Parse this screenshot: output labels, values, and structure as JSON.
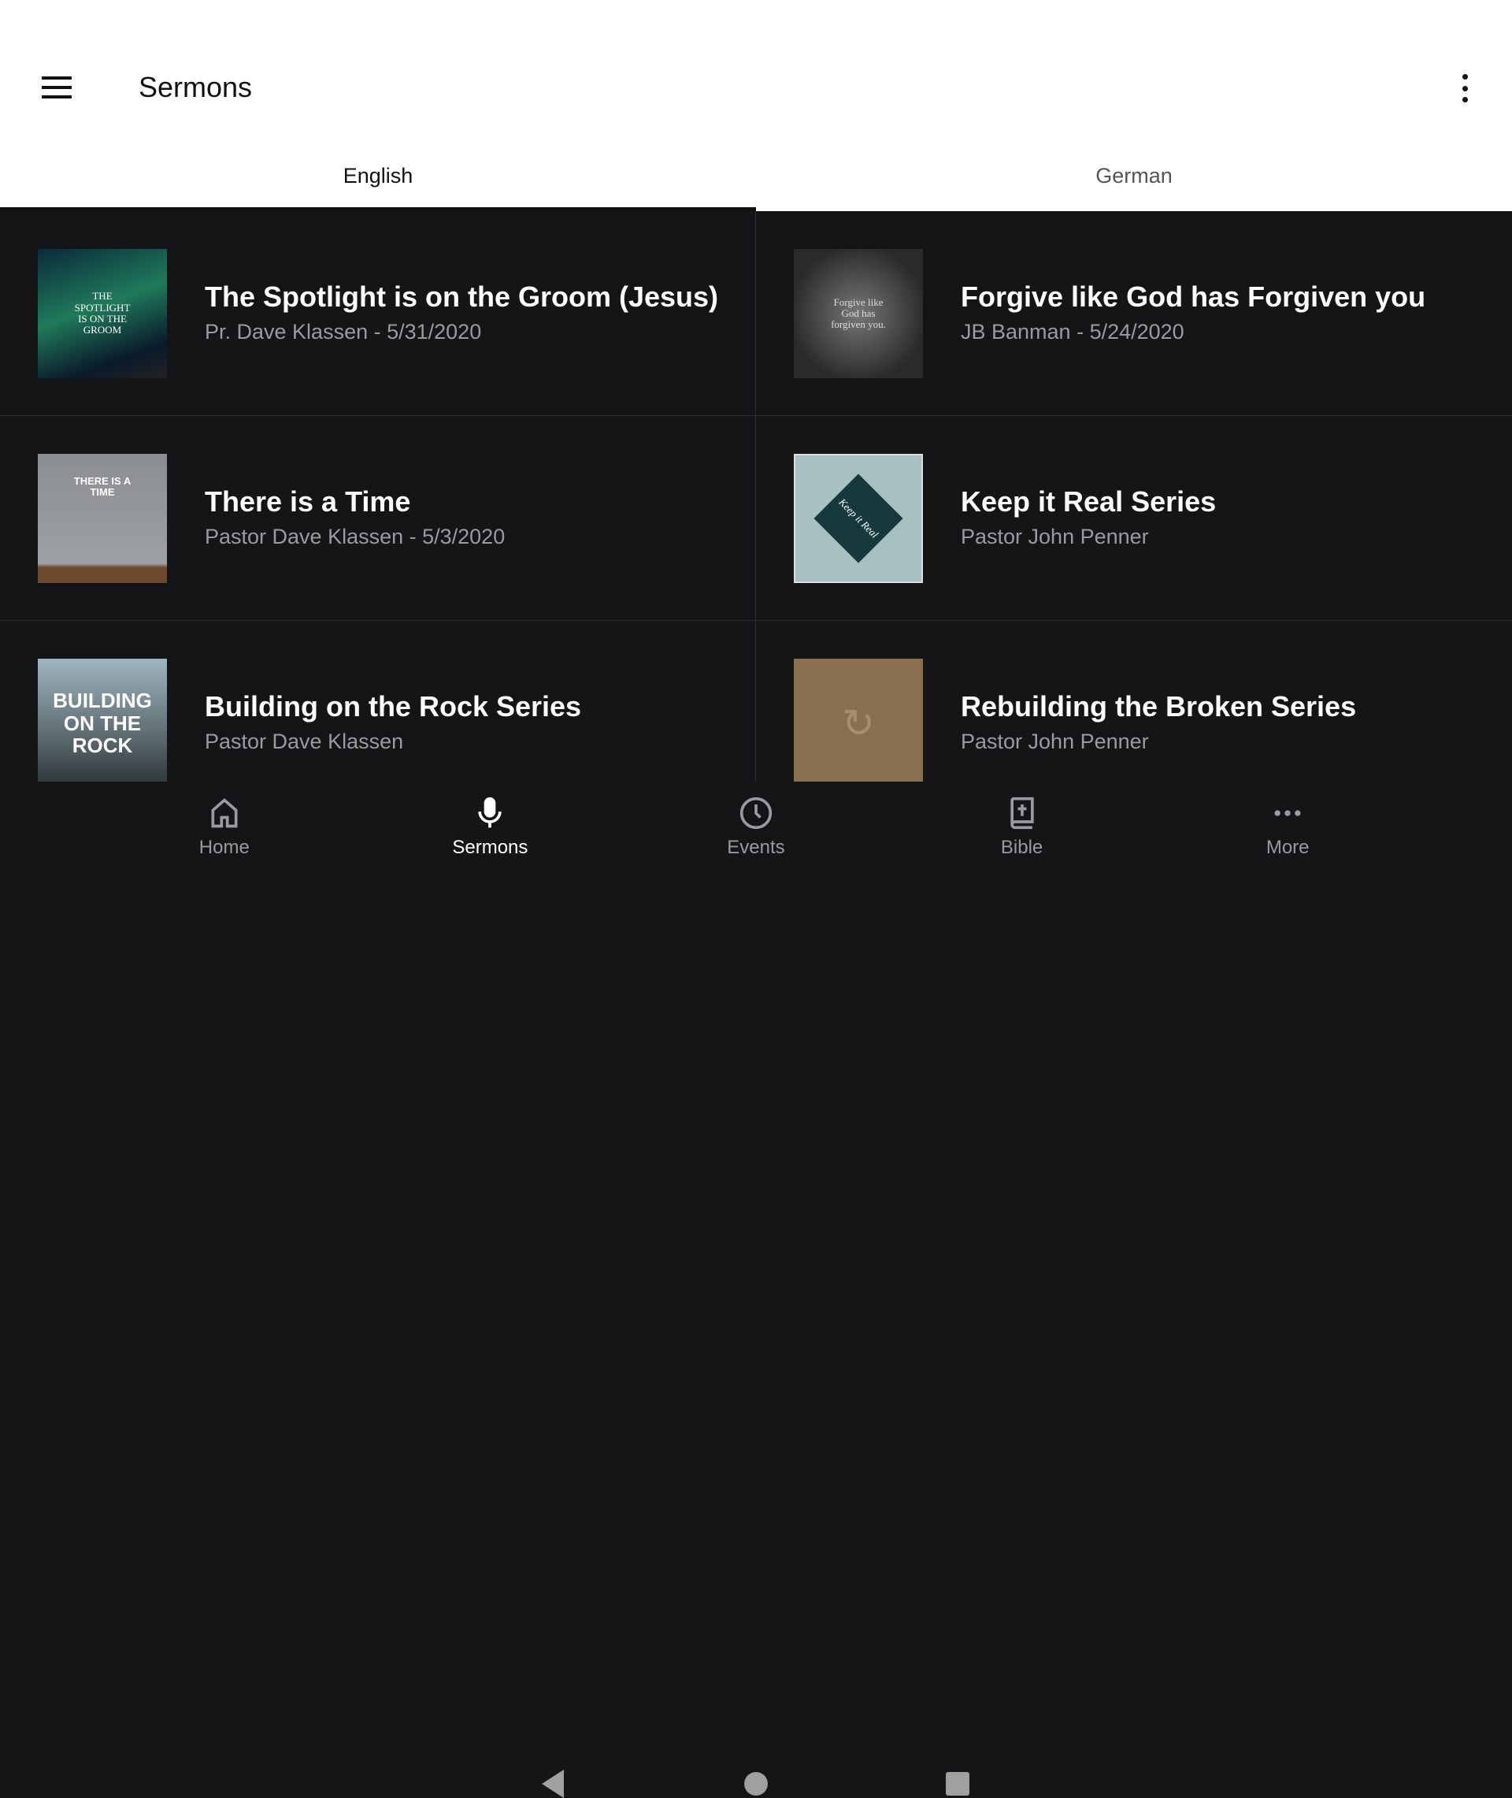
{
  "appbar": {
    "title": "Sermons"
  },
  "tabs": [
    {
      "label": "English",
      "active": true
    },
    {
      "label": "German",
      "active": false
    }
  ],
  "sermons": [
    {
      "title": "The Spotlight is on the Groom (Jesus)",
      "subtitle": "Pr. Dave Klassen - 5/31/2020",
      "thumb_text": "THE SPOTLIGHT IS ON THE GROOM"
    },
    {
      "title": "Forgive like God has Forgiven you",
      "subtitle": "JB Banman - 5/24/2020",
      "thumb_text": "Forgive like God has forgiven you."
    },
    {
      "title": "There is a Time",
      "subtitle": "Pastor Dave Klassen - 5/3/2020",
      "thumb_text": "THERE IS A TIME"
    },
    {
      "title": "Keep it Real Series",
      "subtitle": "Pastor John Penner",
      "thumb_text": "Keep it Real"
    },
    {
      "title": "Building on the Rock Series",
      "subtitle": "Pastor Dave Klassen",
      "thumb_text": "BUILDING ON THE ROCK"
    },
    {
      "title": "Rebuilding the Broken Series",
      "subtitle": "Pastor John Penner",
      "thumb_text": ""
    }
  ],
  "bottom_nav": [
    {
      "label": "Home",
      "icon": "home-icon"
    },
    {
      "label": "Sermons",
      "icon": "microphone-icon",
      "active": true
    },
    {
      "label": "Events",
      "icon": "clock-icon"
    },
    {
      "label": "Bible",
      "icon": "bible-icon"
    },
    {
      "label": "More",
      "icon": "more-horizontal-icon"
    }
  ],
  "colors": {
    "background": "#141517",
    "appbar": "#ffffff",
    "subtitle": "#9a9b9e"
  }
}
